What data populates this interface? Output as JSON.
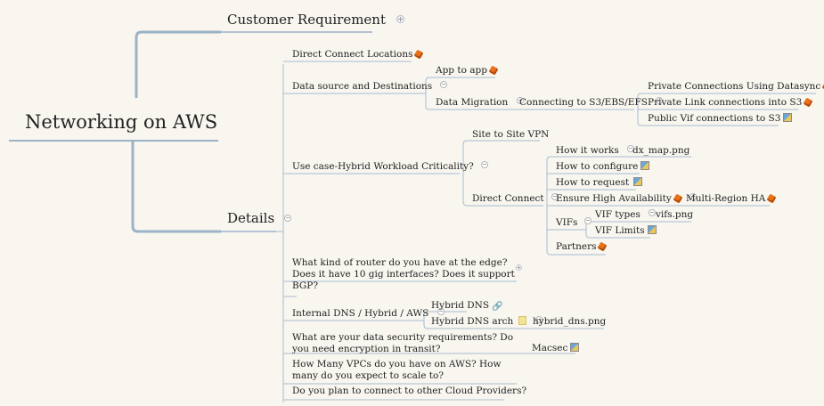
{
  "root": {
    "label": "Networking on AWS"
  },
  "customer_requirement": {
    "label": "Customer Requirement"
  },
  "details": {
    "label": "Details"
  },
  "nodes": {
    "direct_connect_locations": "Direct Connect Locations",
    "data_source": "Data source and Destinations",
    "app_to_app": "App to app",
    "data_migration": "Data Migration",
    "connecting_s3": "Connecting to S3/EBS/EFS",
    "private_datasync": "Private Connections Using Datasync",
    "private_link": "Private Link connections into S3",
    "public_vif": "Public Vif connections to S3",
    "hybrid_workload": "Use case-Hybrid Workload Criticality?",
    "site_to_site": "Site to Site VPN",
    "direct_connect": "Direct Connect",
    "how_it_works": "How it works",
    "dx_map": "dx_map.png",
    "how_to_configure": "How to configure",
    "how_to_request": "How to request",
    "ensure_ha": "Ensure High Availability",
    "multi_region": "Multi-Region HA",
    "vifs": "VIFs",
    "vif_types": "VIF types",
    "vifs_png": "vifs.png",
    "vif_limits": "VIF Limits",
    "partners": "Partners",
    "router_question": "What kind of router do you have at the edge? Does it have 10 gig interfaces? Does it support BGP?",
    "internal_dns": "Internal DNS / Hybrid / AWS",
    "hybrid_dns": "Hybrid DNS",
    "hybrid_dns_arch": "Hybrid DNS arch",
    "hybrid_dns_png": "hybrid_dns.png",
    "security_question": "What are your data security requirements? Do you need encryption in transit?",
    "macsec": "Macsec",
    "vpcs_question": "How Many VPCs do you have on AWS? How many do you expect to scale to?",
    "cloud_providers": "Do you plan to connect to other Cloud Providers?"
  },
  "colors": {
    "line": "#a9bcd0",
    "trunk": "#8ea6c0",
    "background": "#f8f6ef"
  },
  "icons": [
    "aws-resource-icon",
    "image-attachment-icon",
    "link-icon",
    "note-icon",
    "collapse-icon",
    "expand-icon"
  ]
}
